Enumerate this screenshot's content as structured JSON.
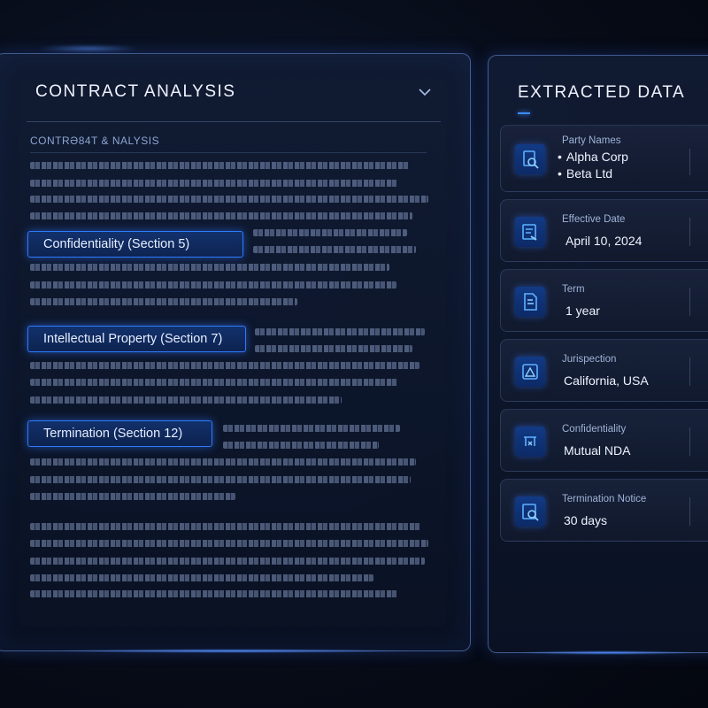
{
  "left_panel": {
    "title": "CONTRACT ANALYSIS",
    "subheading": "CONTRƏ84T & NALYSIS",
    "clauses": [
      {
        "label": "Confidentiality (Section 5)"
      },
      {
        "label": "Intellectual Property (Section 7)"
      },
      {
        "label": "Termination (Section 12)"
      }
    ]
  },
  "right_panel": {
    "title": "EXTRACTED DATA",
    "cards": [
      {
        "label": "Party Names",
        "values": [
          "Alpha Corp",
          "Beta Ltd"
        ],
        "icon": "search-document-icon"
      },
      {
        "label": "Effective Date",
        "value": "April 10, 2024",
        "icon": "calendar-icon"
      },
      {
        "label": "Term",
        "value": "1 year",
        "icon": "document-icon"
      },
      {
        "label": "Jurispection",
        "value": "California, USA",
        "icon": "jurisdiction-icon"
      },
      {
        "label": "Confidentiality",
        "value": "Mutual NDA",
        "icon": "confidentiality-icon"
      },
      {
        "label": "Termination Notice",
        "value": "30 days",
        "icon": "termination-icon"
      }
    ]
  },
  "colors": {
    "accent": "#2f7bff",
    "background": "#070c18",
    "panel_border": "#6e96e6"
  }
}
